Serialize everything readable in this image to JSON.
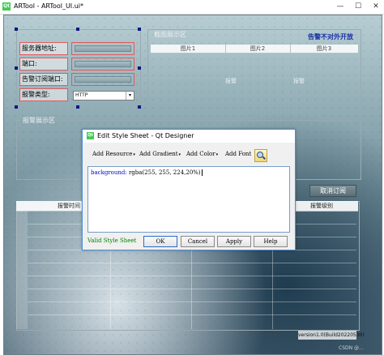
{
  "window": {
    "app_icon": "Qt",
    "title": "ARTool - ARTool_UI.ui*",
    "controls": {
      "minimize": "—",
      "maximize": "☐",
      "close": "✕"
    }
  },
  "form": {
    "labels": [
      "服务器地址:",
      "端口:",
      "告警订阅端口:",
      "报警类型:"
    ],
    "protocol_select": "HTTP",
    "protocol_arrow": "▾"
  },
  "image_group": {
    "title": "截图展示区",
    "notify_text": "告警不对外开放",
    "columns": [
      "图片1",
      "图片2",
      "图片3"
    ],
    "cells": [
      "报警",
      "报警"
    ]
  },
  "alarm_group": {
    "title": "报警展示区"
  },
  "cancel_subscribe_label": "取消订阅",
  "table": {
    "headers": [
      "报警时间",
      "报警级别"
    ]
  },
  "version_text": "version1.0(Build20220530)",
  "watermark": "CSDN @...",
  "dialog": {
    "icon": "Qt",
    "title": "Edit Style Sheet - Qt Designer",
    "toolbar": {
      "add_resource": "Add Resource",
      "add_gradient": "Add Gradient",
      "add_color": "Add Color",
      "add_font": "Add Font",
      "arrow": "▾"
    },
    "editor": {
      "property": "background:",
      "value": "rgba(255, 255, 224,20%)"
    },
    "status": "Valid Style Sheet",
    "buttons": {
      "ok": "OK",
      "cancel": "Cancel",
      "apply": "Apply",
      "help": "Help"
    }
  }
}
